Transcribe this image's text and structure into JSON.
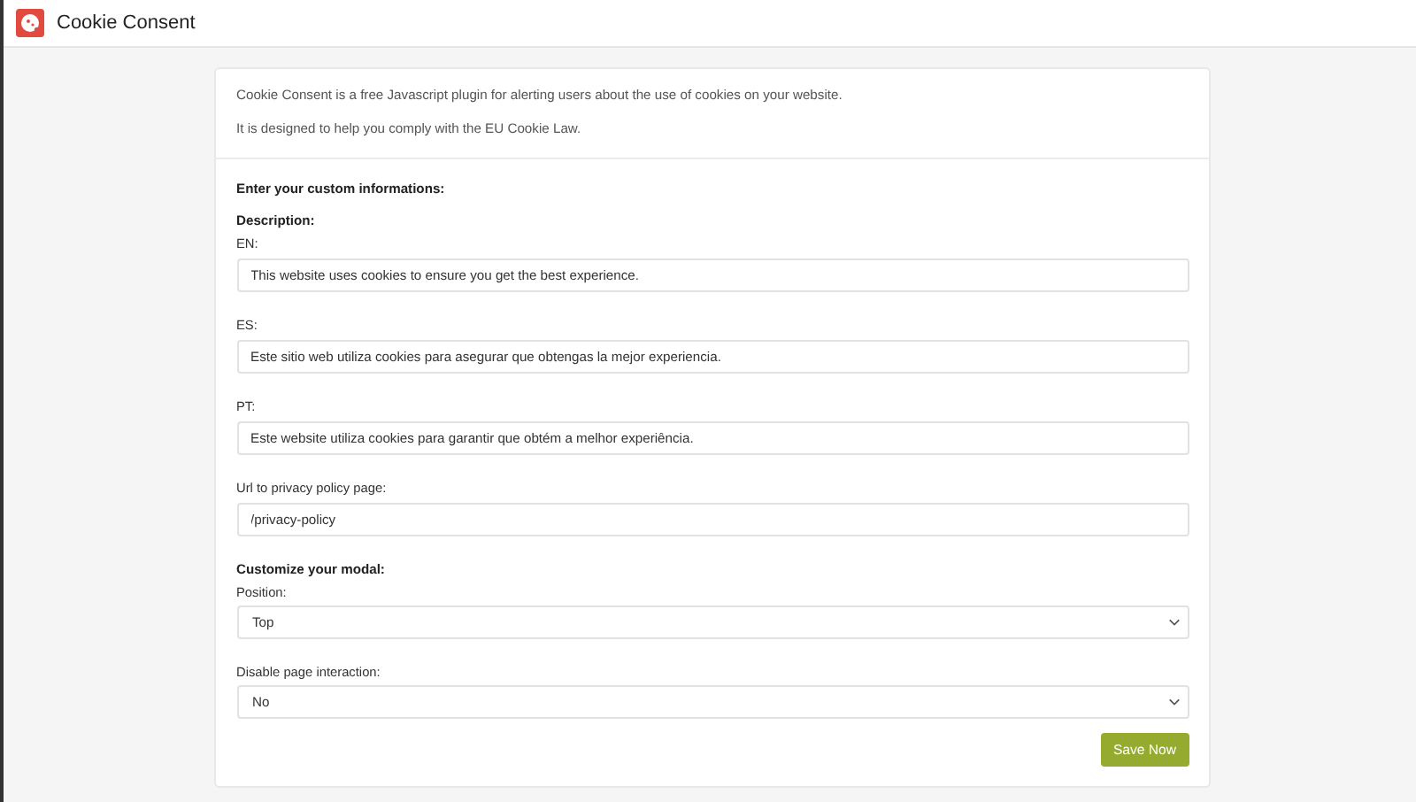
{
  "app": {
    "title": "Cookie Consent"
  },
  "intro": [
    "Cookie Consent is a free Javascript plugin for alerting users about the use of cookies on your website.",
    "It is designed to help you comply with the EU Cookie Law."
  ],
  "sections": [
    {
      "heading": "Enter your custom informations:",
      "subheading": "Description:",
      "fields": [
        {
          "kind": "text",
          "label": "EN:",
          "value": "This website uses cookies to ensure you get the best experience."
        },
        {
          "kind": "text",
          "label": "ES:",
          "value": "Este sitio web utiliza cookies para asegurar que obtengas la mejor experiencia."
        },
        {
          "kind": "text",
          "label": "PT:",
          "value": "Este website utiliza cookies para garantir que obtém a melhor experiência."
        },
        {
          "kind": "text",
          "label": "Url to privacy policy page:",
          "value": "/privacy-policy"
        }
      ]
    },
    {
      "heading": "Customize your modal:",
      "fields": [
        {
          "kind": "select",
          "label": "Position:",
          "value": "Top"
        },
        {
          "kind": "select",
          "label": "Disable page interaction:",
          "value": "No"
        }
      ]
    }
  ],
  "save_button": "Save Now"
}
